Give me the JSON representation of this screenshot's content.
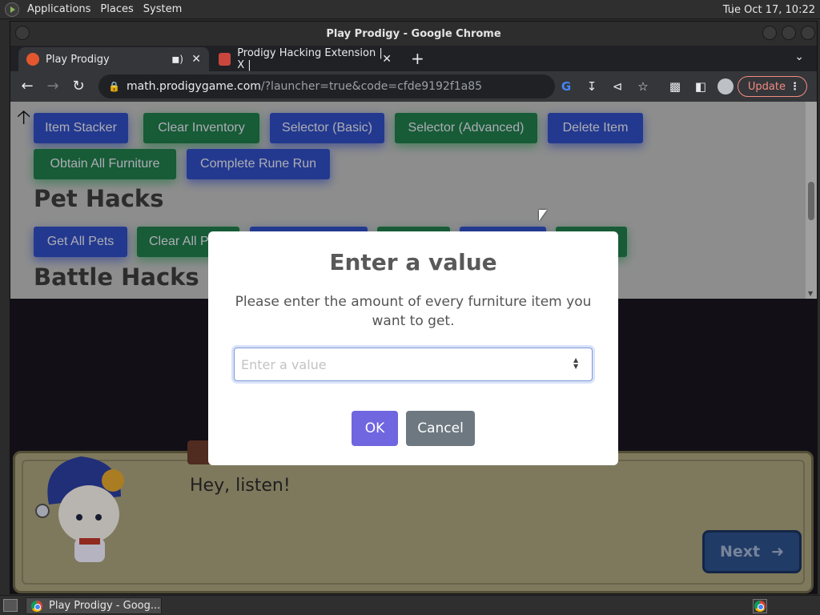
{
  "top_panel": {
    "menus": [
      "Applications",
      "Places",
      "System"
    ],
    "clock": "Tue Oct 17, 10:22"
  },
  "window": {
    "title": "Play Prodigy - Google Chrome"
  },
  "tabs": [
    {
      "label": "Play Prodigy",
      "favicon": "prodigy-icon"
    },
    {
      "label": "Prodigy Hacking Extension | X |",
      "favicon": "extension-icon"
    }
  ],
  "toolbar": {
    "url_host": "math.prodigygame.com",
    "url_rest": "/?launcher=true&code=cfde9192f1a85",
    "update_label": "Update"
  },
  "hacks": {
    "row1": [
      "Item Stacker",
      "Clear Inventory",
      "Selector (Basic)",
      "Selector (Advanced)",
      "Delete Item"
    ],
    "row2": [
      "Obtain All Furniture",
      "Complete Rune Run"
    ],
    "pet_title": "Pet Hacks",
    "pet_row": [
      "Get All Pets",
      "Clear All P"
    ],
    "battle_title": "Battle Hacks"
  },
  "game": {
    "line": "Hey, listen!",
    "next_label": "Next"
  },
  "modal": {
    "title": "Enter a value",
    "text": "Please enter the amount of every furniture item you want to get.",
    "placeholder": "Enter a value",
    "ok": "OK",
    "cancel": "Cancel"
  },
  "taskbar": {
    "task_label": "Play Prodigy - Goog..."
  },
  "colors": {
    "ok_button": "#7066e0",
    "cancel_button": "#6e7881",
    "hack_blue": "#2f4dbf",
    "hack_green": "#1f7a4a"
  }
}
